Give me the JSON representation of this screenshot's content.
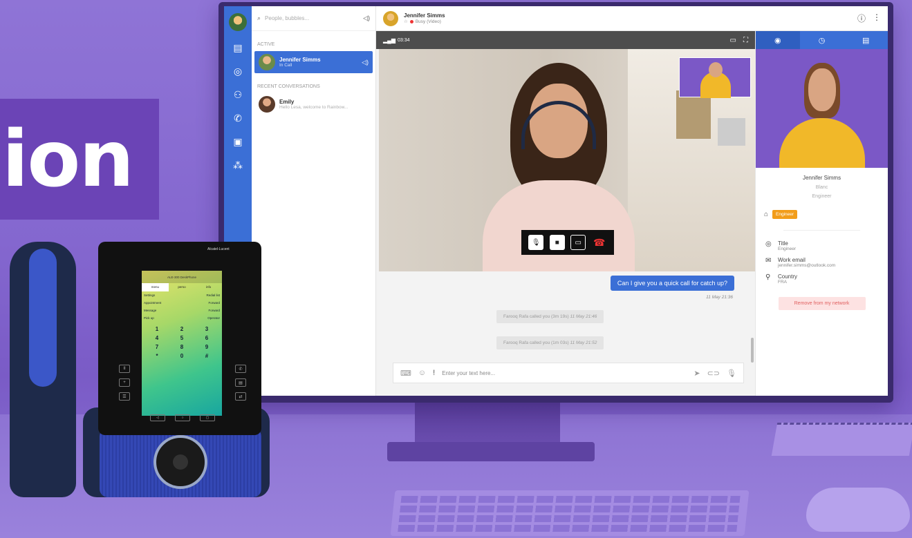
{
  "headline": {
    "text": "ion"
  },
  "app": {
    "search": {
      "placeholder": "People, bubbles..."
    },
    "sections": {
      "active": "ACTIVE",
      "recent": "RECENT CONVERSATIONS"
    },
    "conversations": [
      {
        "name": "Jennifer Simms",
        "status": "In Call",
        "active": true
      },
      {
        "name": "Emily",
        "status": "Hello Lesa, welcome to Rainbow...",
        "active": false
      }
    ],
    "header": {
      "name": "Jennifer Simms",
      "presence": "Busy (Video)"
    },
    "call": {
      "timer": "03:34"
    },
    "chat": {
      "outgoing": {
        "text": "Can I give you a quick call for catch up?",
        "time": "11 May 21:36"
      },
      "system": [
        {
          "text": "Farooq Rafa called you (3m 19s)",
          "time": "11 May 21:46"
        },
        {
          "text": "Farooq Rafa called you (1m 03s)",
          "time": "11 May 21:52"
        }
      ]
    },
    "composer": {
      "placeholder": "Enter your text here..."
    },
    "profile": {
      "name": "Jennifer Simms",
      "company": "Blanc",
      "role": "Engineer",
      "tag": "Engineer",
      "fields": [
        {
          "label": "Title",
          "value": "Engineer",
          "icon": "person-icon"
        },
        {
          "label": "Work email",
          "value": "jennifer.simms@outlook.com",
          "icon": "mail-icon"
        },
        {
          "label": "Country",
          "value": "FRA",
          "icon": "location-icon"
        }
      ],
      "remove_label": "Remove from my network"
    }
  },
  "deskphone": {
    "brand": "Alcatel-Lucent",
    "screen_header": "ALE-300 DeskPhone",
    "tabs": [
      "menu",
      "perso",
      "info"
    ],
    "rows": [
      [
        "Settings",
        "Redial list"
      ],
      [
        "Appointment",
        "Forward"
      ],
      [
        "Message",
        "Forward"
      ],
      [
        "Pick up",
        "Operator"
      ]
    ],
    "keys": [
      "1",
      "2",
      "3",
      "4",
      "5",
      "6",
      "7",
      "8",
      "9",
      "*",
      "0",
      "#"
    ]
  },
  "colors": {
    "brand_blue": "#3b6fd6",
    "purple": "#7b58c6",
    "headline_bg": "#6b44b6",
    "tag_orange": "#f29d1b"
  }
}
